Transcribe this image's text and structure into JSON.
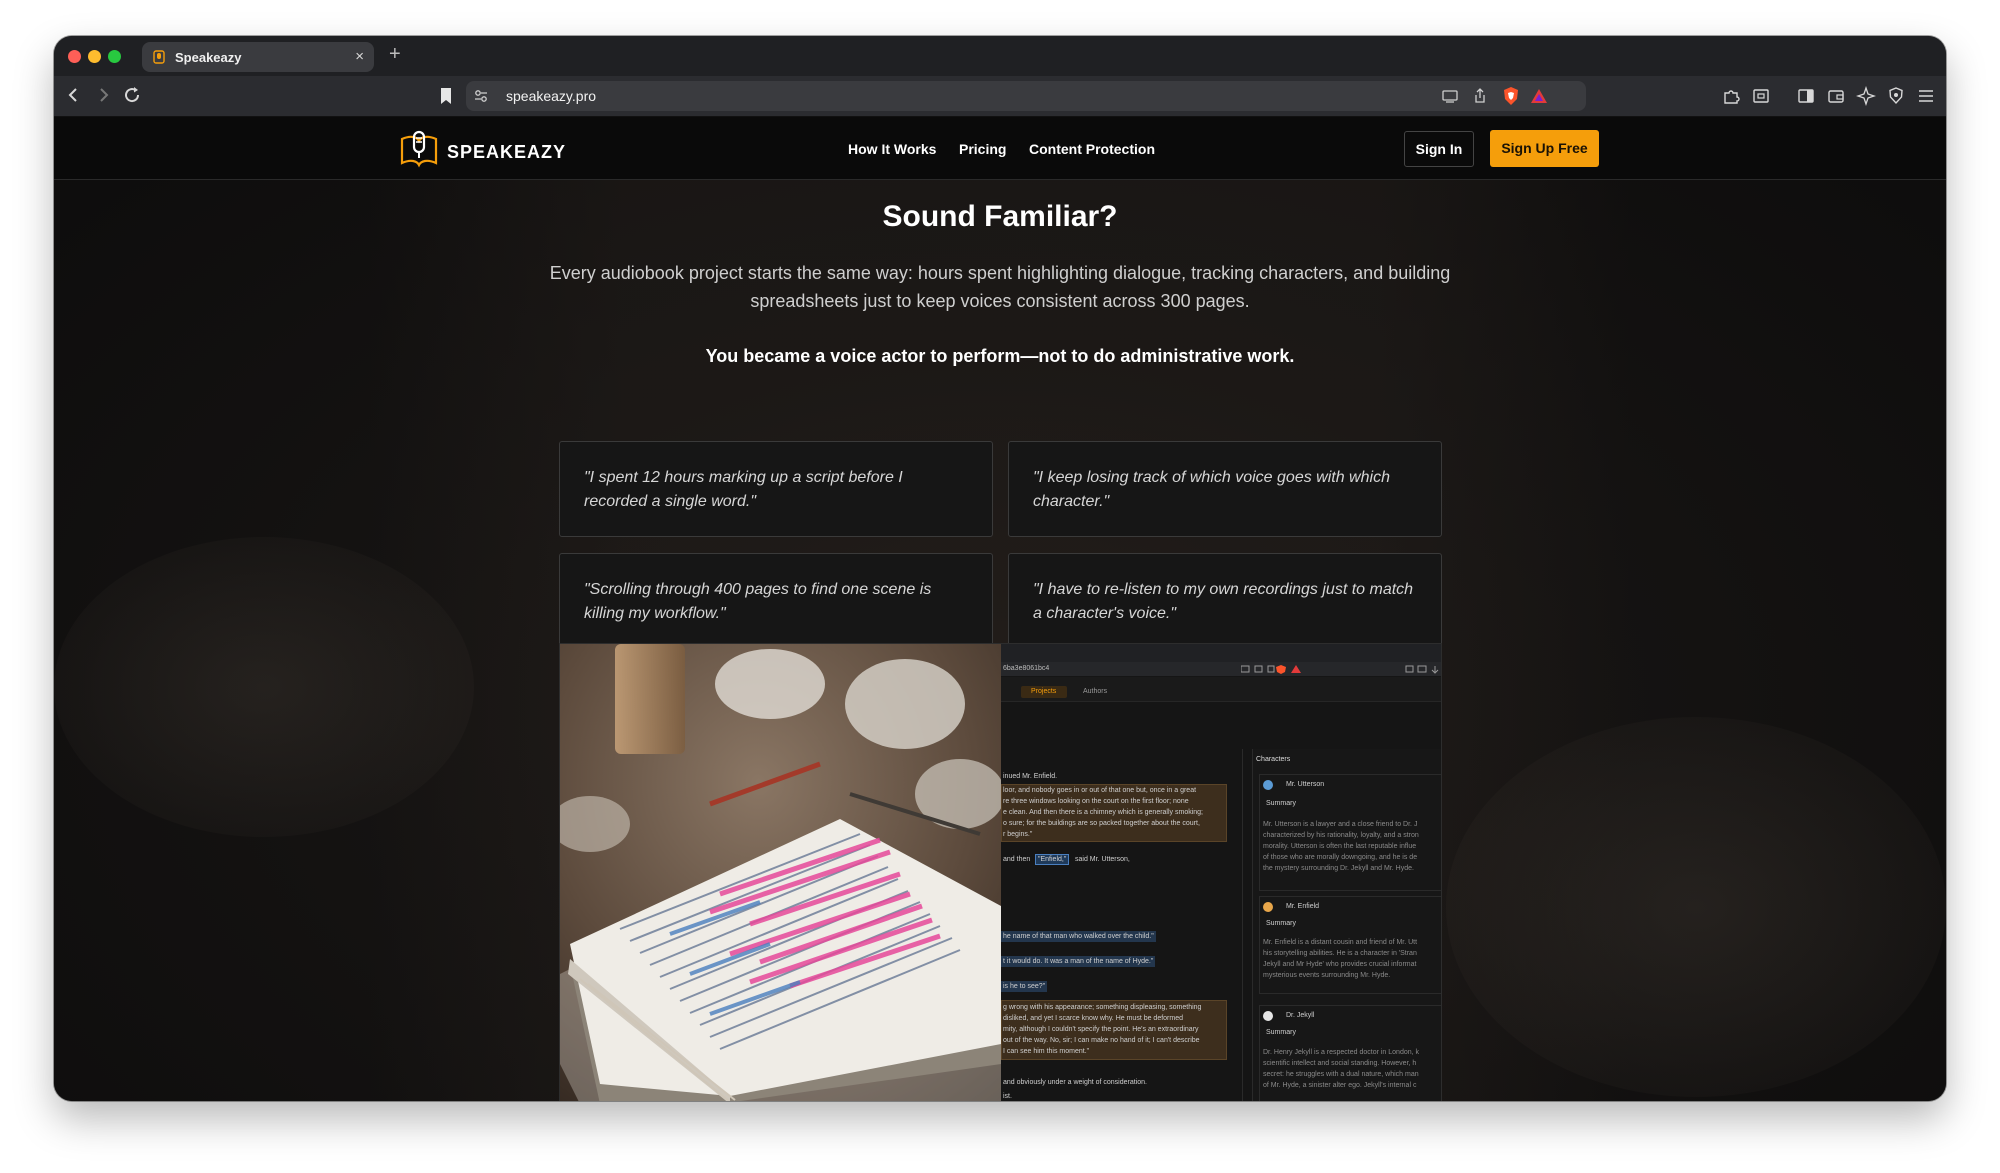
{
  "browser": {
    "tab_title": "Speakeazy",
    "url": "speakeazy.pro"
  },
  "site": {
    "brand": "SPEAKEAZY",
    "nav": {
      "how_it_works": "How It Works",
      "pricing": "Pricing",
      "content_protection": "Content Protection"
    },
    "sign_in": "Sign In",
    "sign_up": "Sign Up Free"
  },
  "hero": {
    "title": "Sound Familiar?",
    "intro": "Every audiobook project starts the same way: hours spent highlighting dialogue, tracking characters, and building spreadsheets just to keep voices consistent across 300 pages.",
    "emphasis": "You became a voice actor to perform—not to do administrative work."
  },
  "quotes": [
    "\"I spent 12 hours marking up a script before I recorded a single word.\"",
    "\"I keep losing track of which voice goes with which character.\"",
    "\"Scrolling through 400 pages to find one scene is killing my workflow.\"",
    "\"I have to re-listen to my own recordings just to match a character's voice.\""
  ],
  "app_screenshot": {
    "tab_projects": "Projects",
    "tab_authors": "Authors",
    "url_fragment": "6ba3e8061bc4",
    "characters_header": "Characters",
    "summary_label": "Summary",
    "text_lines": {
      "a": "inued Mr. Enfield.",
      "b": "loor, and nobody goes in or out of that one but, once in a great",
      "c": "re three windows looking on the court on the first floor; none",
      "d": "e clean. And then there is a chimney which is generally smoking;",
      "e": "o sure; for the buildings are so packed together about the court,",
      "f": "r begins.\"",
      "g": "and then",
      "g_tag": "\"Enfield,\"",
      "g_end": "said Mr. Utterson,",
      "h": "he name of that man who walked over the child.\"",
      "i": "t it would do. It was a man of the name of Hyde.\"",
      "j": "is he to see?\"",
      "k": "g wrong with his appearance; something displeasing, something",
      "l": "disliked, and yet I scarce know why. He must be deformed",
      "m": "mity, although I couldn't specify the point. He's an extraordinary",
      "n": "out of the way. No, sir; I can make no hand of it; I can't describe",
      "o": "I can see him this moment.\"",
      "p": "and obviously under a weight of consideration.",
      "q": "ist."
    },
    "characters": [
      {
        "name": "Mr. Utterson",
        "color": "#5b9bd5",
        "summary": [
          "Mr. Utterson is a lawyer and a close friend to Dr. J",
          "characterized by his rationality, loyalty, and a stron",
          "morality. Utterson is often the last reputable influe",
          "of those who are morally downgoing, and he is de",
          "the mystery surrounding Dr. Jekyll and Mr. Hyde."
        ]
      },
      {
        "name": "Mr. Enfield",
        "color": "#e8a64a",
        "summary": [
          "Mr. Enfield is a distant cousin and friend of Mr. Utt",
          "his storytelling abilities. He is a character in 'Stran",
          "Jekyll and Mr Hyde' who provides crucial informat",
          "mysterious events surrounding Mr. Hyde."
        ]
      },
      {
        "name": "Dr. Jekyll",
        "color": "#e6e6e6",
        "summary": [
          "Dr. Henry Jekyll is a respected doctor in London, k",
          "scientific intellect and social standing. However, h",
          "secret: he struggles with a dual nature, which man",
          "of Mr. Hyde, a sinister alter ego. Jekyll's internal c"
        ]
      }
    ]
  },
  "colors": {
    "accent": "#f59e0b",
    "page_bg": "#0d0c0c",
    "card_bg": "#161616"
  }
}
